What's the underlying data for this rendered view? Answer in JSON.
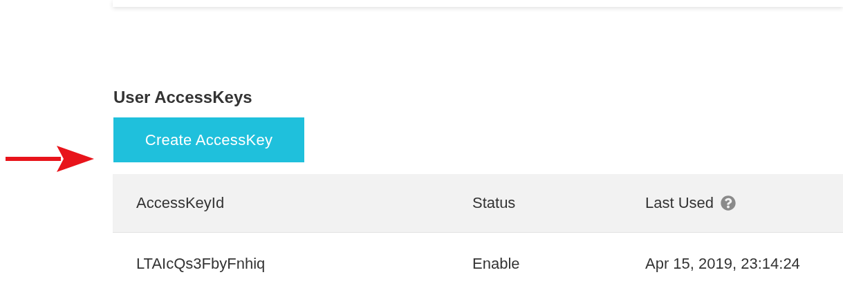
{
  "section_title": "User AccessKeys",
  "create_button": {
    "label": "Create AccessKey"
  },
  "annotation": {
    "kind": "arrow",
    "color": "#e8141b"
  },
  "table": {
    "columns": [
      {
        "label": "AccessKeyId",
        "help": false
      },
      {
        "label": "Status",
        "help": false
      },
      {
        "label": "Last Used",
        "help": true
      }
    ],
    "rows": [
      [
        "LTAIcQs3FbyFnhiq",
        "Enable",
        "Apr 15, 2019, 23:14:24"
      ]
    ]
  }
}
